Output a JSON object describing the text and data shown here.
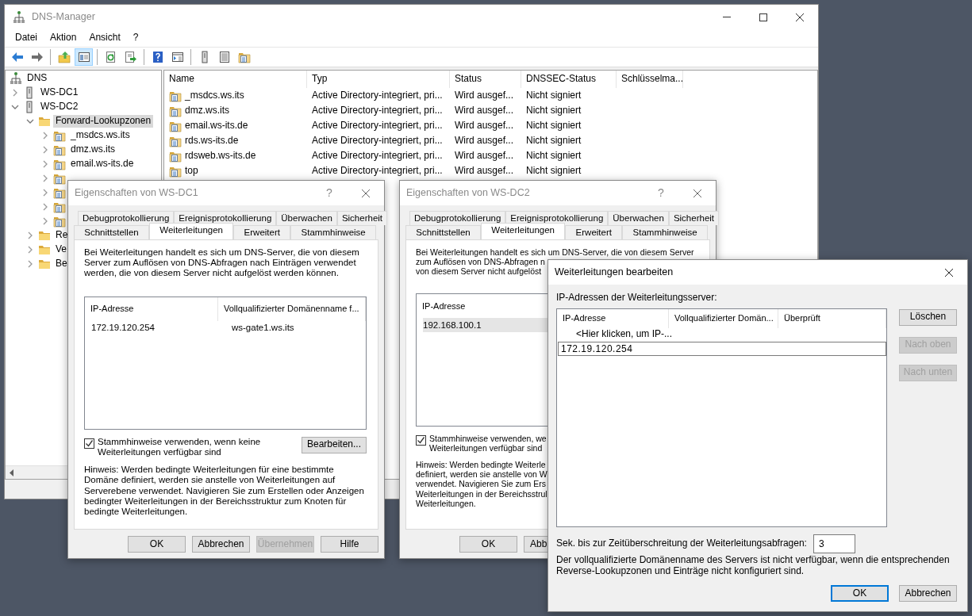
{
  "main_window": {
    "title": "DNS-Manager",
    "menu": [
      "Datei",
      "Aktion",
      "Ansicht",
      "?"
    ],
    "toolbar": [
      {
        "kind": "back",
        "pressed": false
      },
      {
        "kind": "forward",
        "pressed": false
      },
      {
        "kind": "separator"
      },
      {
        "kind": "up",
        "pressed": false
      },
      {
        "kind": "tree",
        "pressed": true
      },
      {
        "kind": "separator"
      },
      {
        "kind": "refresh",
        "pressed": false
      },
      {
        "kind": "export",
        "pressed": false
      },
      {
        "kind": "separator"
      },
      {
        "kind": "help",
        "pressed": false
      },
      {
        "kind": "console",
        "pressed": false
      },
      {
        "kind": "separator"
      },
      {
        "kind": "server",
        "pressed": false
      },
      {
        "kind": "list",
        "pressed": false
      },
      {
        "kind": "zones",
        "pressed": false
      }
    ],
    "tree": [
      {
        "label": "DNS",
        "kind": "root",
        "selected": false,
        "children": [
          {
            "label": "WS-DC1",
            "kind": "server",
            "expanded": false,
            "selected": false
          },
          {
            "label": "WS-DC2",
            "kind": "server",
            "expanded": true,
            "selected": false,
            "children": [
              {
                "label": "Forward-Lookupzonen",
                "kind": "folder",
                "expanded": true,
                "selected": true,
                "children": [
                  {
                    "label": "_msdcs.ws.its",
                    "kind": "zone",
                    "expanded": false,
                    "selected": false
                  },
                  {
                    "label": "dmz.ws.its",
                    "kind": "zone",
                    "expanded": false,
                    "selected": false
                  },
                  {
                    "label": "email.ws-its.de",
                    "kind": "zone",
                    "expanded": false,
                    "selected": false
                  },
                  {
                    "kind": "zone",
                    "expanded": false
                  },
                  {
                    "kind": "zone",
                    "expanded": false
                  },
                  {
                    "kind": "zone",
                    "expanded": false
                  },
                  {
                    "kind": "zone",
                    "expanded": false
                  }
                ]
              },
              {
                "label": "Re",
                "kind": "folder",
                "expanded": false,
                "selected": false
              },
              {
                "label": "Ve",
                "kind": "folder",
                "expanded": false,
                "selected": false
              },
              {
                "label": "Be",
                "kind": "folder",
                "expanded": false,
                "selected": false
              }
            ]
          }
        ]
      }
    ],
    "list": {
      "columns": [
        "Name",
        "Typ",
        "Status",
        "DNSSEC-Status",
        "Schlüsselma..."
      ],
      "rows": [
        {
          "cells": [
            "_msdcs.ws.its",
            "Active Directory-integriert, pri...",
            "Wird ausgef...",
            "Nicht signiert"
          ]
        },
        {
          "cells": [
            "dmz.ws.its",
            "Active Directory-integriert, pri...",
            "Wird ausgef...",
            "Nicht signiert"
          ]
        },
        {
          "cells": [
            "email.ws-its.de",
            "Active Directory-integriert, pri...",
            "Wird ausgef...",
            "Nicht signiert"
          ]
        },
        {
          "cells": [
            "rds.ws-its.de",
            "Active Directory-integriert, pri...",
            "Wird ausgef...",
            "Nicht signiert"
          ]
        },
        {
          "cells": [
            "rdsweb.ws-its.de",
            "Active Directory-integriert, pri...",
            "Wird ausgef...",
            "Nicht signiert"
          ]
        },
        {
          "cells": [
            "top",
            "Active Directory-integriert, pri...",
            "Wird ausgef...",
            "Nicht signiert"
          ]
        }
      ]
    }
  },
  "dialogs": [
    {
      "title": "Eigenschaften von WS-DC1",
      "active": false,
      "help": "?",
      "tabs": [
        [
          {
            "label": "Debugprotokollierung",
            "selected": false
          },
          {
            "label": "Ereignisprotokollierung",
            "selected": false
          },
          {
            "label": "Überwachen",
            "selected": false
          },
          {
            "label": "Sicherheit",
            "selected": false
          }
        ],
        [
          {
            "label": "Schnittstellen",
            "selected": false
          },
          {
            "label": "Weiterleitungen",
            "selected": true
          },
          {
            "label": "Erweitert",
            "selected": false
          },
          {
            "label": "Stammhinweise",
            "selected": false
          }
        ]
      ],
      "description": "Bei Weiterleitungen handelt es sich um DNS-Server, die von diesem Server zum Auflösen von DNS-Abfragen nach Einträgen verwendet werden, die von diesem Server nicht aufgelöst werden können.",
      "list": {
        "columns": [
          "IP-Adresse",
          "Vollqualifizierter Domänenname f..."
        ],
        "rows": [
          {
            "cells": [
              "172.19.120.254",
              "ws-gate1.ws.its"
            ],
            "selected": false
          }
        ]
      },
      "checkbox": {
        "label": "Stammhinweise verwenden, wenn keine Weiterleitungen verfügbar sind",
        "checked": true
      },
      "edit_button": "Bearbeiten...",
      "note": "Hinweis: Werden bedingte Weiterleitungen für eine bestimmte Domäne definiert, werden sie anstelle von Weiterleitungen auf Serverebene verwendet. Navigieren Sie zum Erstellen oder Anzeigen bedingter Weiterleitungen in der Bereichsstruktur zum Knoten für bedingte Weiterleitungen.",
      "buttons": [
        {
          "label": "OK",
          "disabled": false
        },
        {
          "label": "Abbrechen",
          "disabled": false
        },
        {
          "label": "Übernehmen",
          "disabled": true
        },
        {
          "label": "Hilfe",
          "disabled": false
        }
      ]
    },
    {
      "title": "Eigenschaften von WS-DC2",
      "active": false,
      "help": "?",
      "tabs": [
        [
          {
            "label": "Debugprotokollierung",
            "selected": false
          },
          {
            "label": "Ereignisprotokollierung",
            "selected": false
          },
          {
            "label": "Überwachen",
            "selected": false
          },
          {
            "label": "Sicherheit",
            "selected": false
          }
        ],
        [
          {
            "label": "Schnittstellen",
            "selected": false
          },
          {
            "label": "Weiterleitungen",
            "selected": true
          },
          {
            "label": "Erweitert",
            "selected": false
          },
          {
            "label": "Stammhinweise",
            "selected": false
          }
        ]
      ],
      "description": [
        "Bei Weiterleitungen handelt es sich um DNS-Server, die von diesem Server",
        "zum Auflösen von DNS-Abfragen n",
        "von diesem Server nicht aufgelöst"
      ],
      "list": {
        "columns": [
          "IP-Adresse"
        ],
        "rows": [
          {
            "cells": [
              "192.168.100.1"
            ],
            "selected": true
          }
        ]
      },
      "checkbox": {
        "label": [
          "Stammhinweise verwenden, we",
          "Weiterleitungen verfügbar sind"
        ],
        "checked": true
      },
      "note": [
        "Hinweis: Werden bedingte Weiterle",
        "definiert, werden sie anstelle von W",
        "verwendet. Navigieren Sie zum Ers",
        "Weiterleitungen in der Bereichsstrul",
        "Weiterleitungen."
      ],
      "buttons": [
        {
          "label": "OK",
          "disabled": false
        },
        {
          "label": "Abb",
          "disabled": false,
          "clipped": true
        }
      ]
    }
  ],
  "edit_dialog": {
    "title": "Weiterleitungen bearbeiten",
    "active": true,
    "servers_label": "IP-Adressen der Weiterleitungsserver:",
    "columns": [
      "IP-Adresse",
      "Vollqualifizierter Domän...",
      "Überprüft"
    ],
    "hint_row": "<Hier klicken, um IP-...",
    "edit_value": "172.19.120.254",
    "side_buttons": [
      {
        "label": "Löschen",
        "disabled": false
      },
      {
        "label": "Nach oben",
        "disabled": true
      },
      {
        "label": "Nach unten",
        "disabled": true
      }
    ],
    "timeout_label": "Sek. bis zur Zeitüberschreitung der Weiterleitungsabfragen:",
    "timeout_value": "3",
    "note": "Der vollqualifizierte Domänenname des Servers ist nicht verfügbar, wenn die entsprechenden Reverse-Lookupzonen und Einträge nicht konfiguriert sind.",
    "buttons": [
      {
        "label": "OK",
        "default": true,
        "disabled": false
      },
      {
        "label": "Abbrechen",
        "default": false,
        "disabled": false
      }
    ]
  }
}
